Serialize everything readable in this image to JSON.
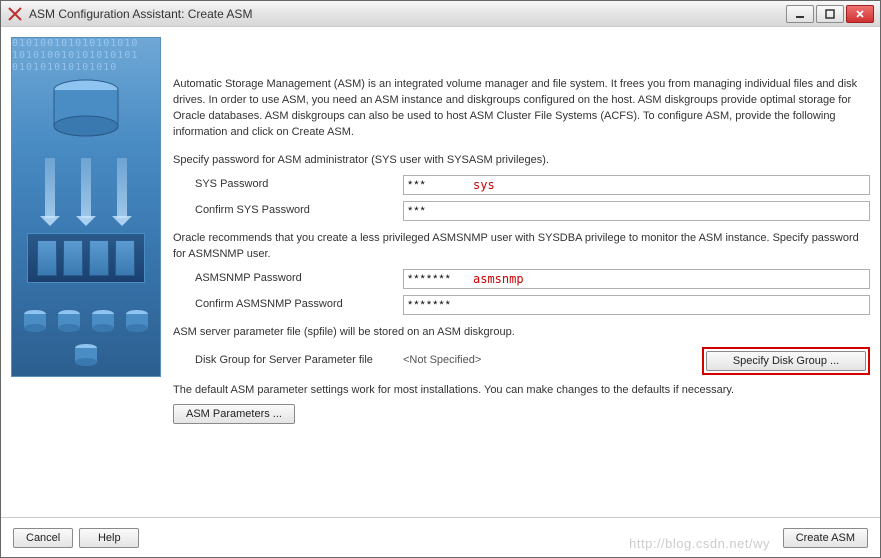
{
  "window": {
    "title": "ASM Configuration Assistant: Create ASM"
  },
  "text": {
    "intro": "Automatic Storage Management (ASM) is an integrated volume manager and file system. It frees you from managing individual files and disk drives. In order to use ASM, you need  an ASM instance and diskgroups configured on the host.  ASM diskgroups provide optimal storage for Oracle databases. ASM diskgroups can also be used to host ASM Cluster File Systems (ACFS). To configure ASM, provide the following information and click on Create ASM.",
    "sys_group_label": "Specify password for ASM administrator (SYS user with SYSASM privileges).",
    "sys_pwd_label": "SYS Password",
    "sys_pwd_value": "***",
    "sys_annotation": "sys",
    "confirm_sys_label": "Confirm SYS Password",
    "confirm_sys_value": "***",
    "asmsnmp_group_label": "Oracle recommends that you create a less privileged ASMSNMP user with SYSDBA privilege to monitor the ASM instance. Specify password for ASMSNMP user.",
    "asmsnmp_pwd_label": "ASMSNMP Password",
    "asmsnmp_pwd_value": "*******",
    "asmsnmp_annotation": "asmsnmp",
    "confirm_asmsnmp_label": "Confirm ASMSNMP Password",
    "confirm_asmsnmp_value": "*******",
    "spfile_label": "ASM server parameter file (spfile) will be stored on an ASM diskgroup.",
    "dg_label": "Disk Group for Server Parameter file",
    "dg_value": "<Not Specified>",
    "dg_button": "Specify Disk Group ...",
    "defaults_label": "The default ASM parameter settings work for most installations. You can make changes to the defaults if necessary.",
    "asm_params_button": "ASM Parameters ..."
  },
  "buttons": {
    "cancel": "Cancel",
    "help": "Help",
    "create": "Create ASM"
  },
  "watermark": "http://blog.csdn.net/wy"
}
